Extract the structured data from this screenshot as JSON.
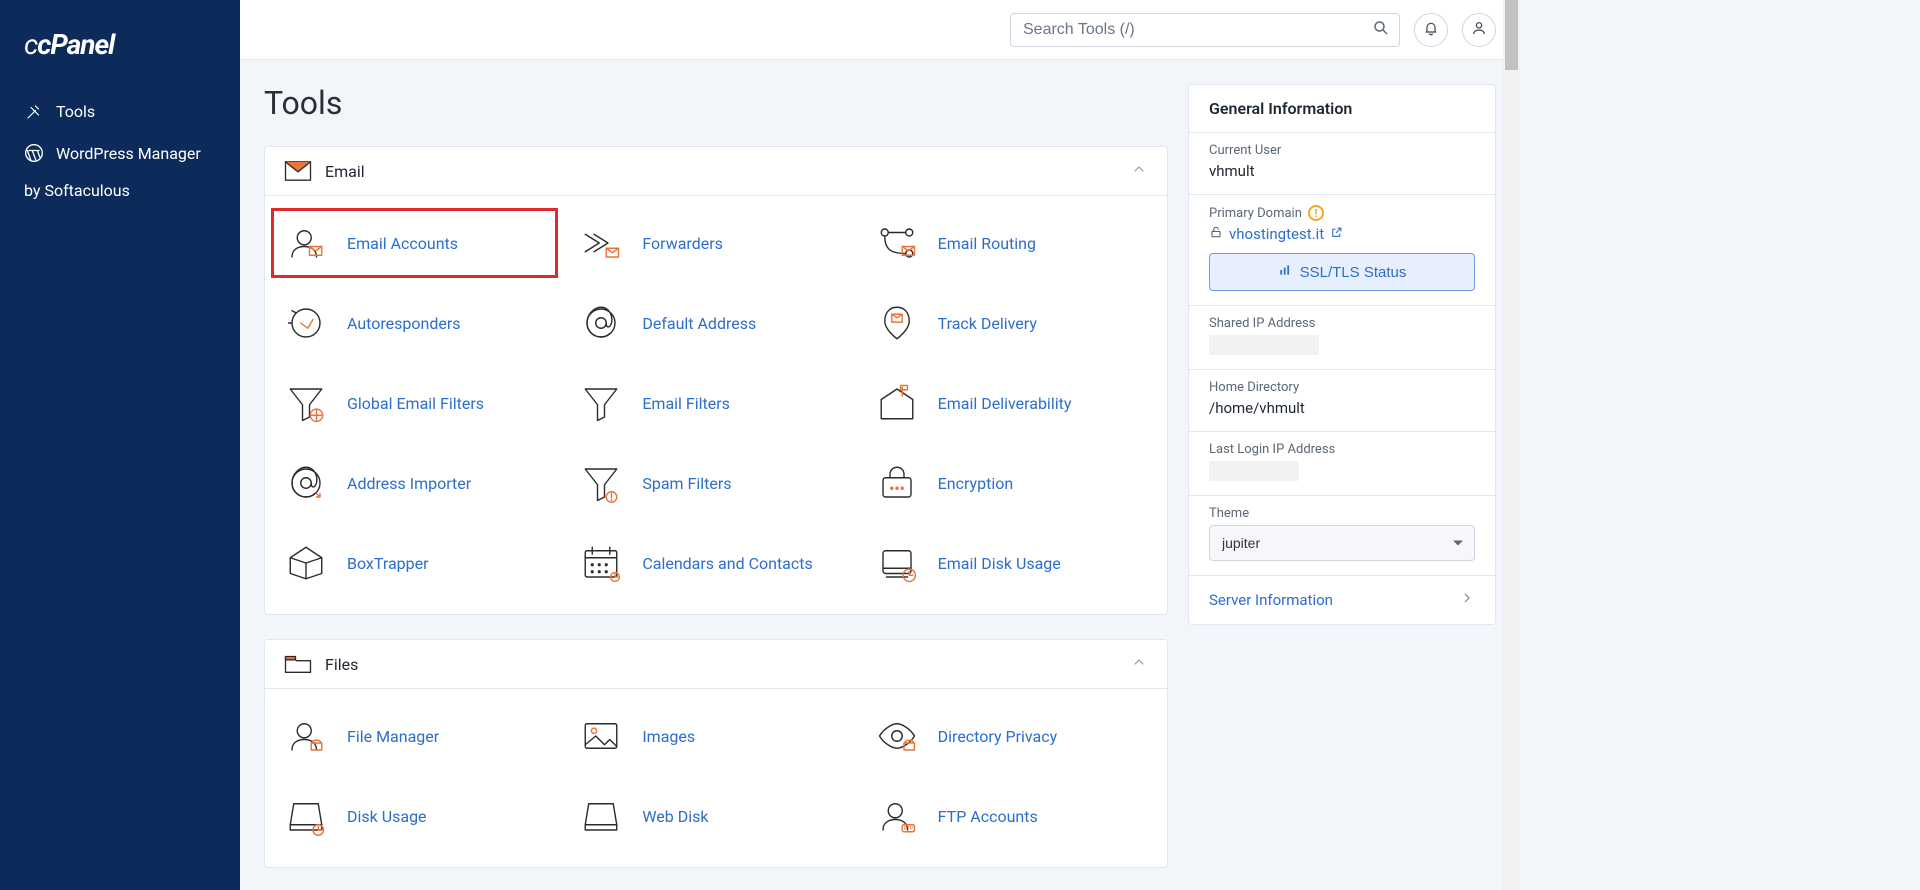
{
  "brand": "cPanel",
  "sidebar": {
    "items": [
      {
        "label": "Tools"
      },
      {
        "label": "WordPress Manager",
        "sub": "by Softaculous"
      }
    ]
  },
  "search": {
    "placeholder": "Search Tools (/)"
  },
  "page": {
    "title": "Tools"
  },
  "sections": [
    {
      "title": "Email",
      "items": [
        {
          "label": "Email Accounts",
          "highlight": true
        },
        {
          "label": "Forwarders"
        },
        {
          "label": "Email Routing"
        },
        {
          "label": "Autoresponders"
        },
        {
          "label": "Default Address"
        },
        {
          "label": "Track Delivery"
        },
        {
          "label": "Global Email Filters"
        },
        {
          "label": "Email Filters"
        },
        {
          "label": "Email Deliverability"
        },
        {
          "label": "Address Importer"
        },
        {
          "label": "Spam Filters"
        },
        {
          "label": "Encryption"
        },
        {
          "label": "BoxTrapper"
        },
        {
          "label": "Calendars and Contacts"
        },
        {
          "label": "Email Disk Usage"
        }
      ]
    },
    {
      "title": "Files",
      "items": [
        {
          "label": "File Manager"
        },
        {
          "label": "Images"
        },
        {
          "label": "Directory Privacy"
        },
        {
          "label": "Disk Usage"
        },
        {
          "label": "Web Disk"
        },
        {
          "label": "FTP Accounts"
        }
      ]
    }
  ],
  "info": {
    "title": "General Information",
    "current_user_label": "Current User",
    "current_user": "vhmult",
    "primary_domain_label": "Primary Domain",
    "primary_domain": "vhostingtest.it",
    "ssl_button": "SSL/TLS Status",
    "shared_ip_label": "Shared IP Address",
    "home_dir_label": "Home Directory",
    "home_dir": "/home/vhmult",
    "last_login_label": "Last Login IP Address",
    "theme_label": "Theme",
    "theme_value": "jupiter",
    "server_info": "Server Information"
  }
}
